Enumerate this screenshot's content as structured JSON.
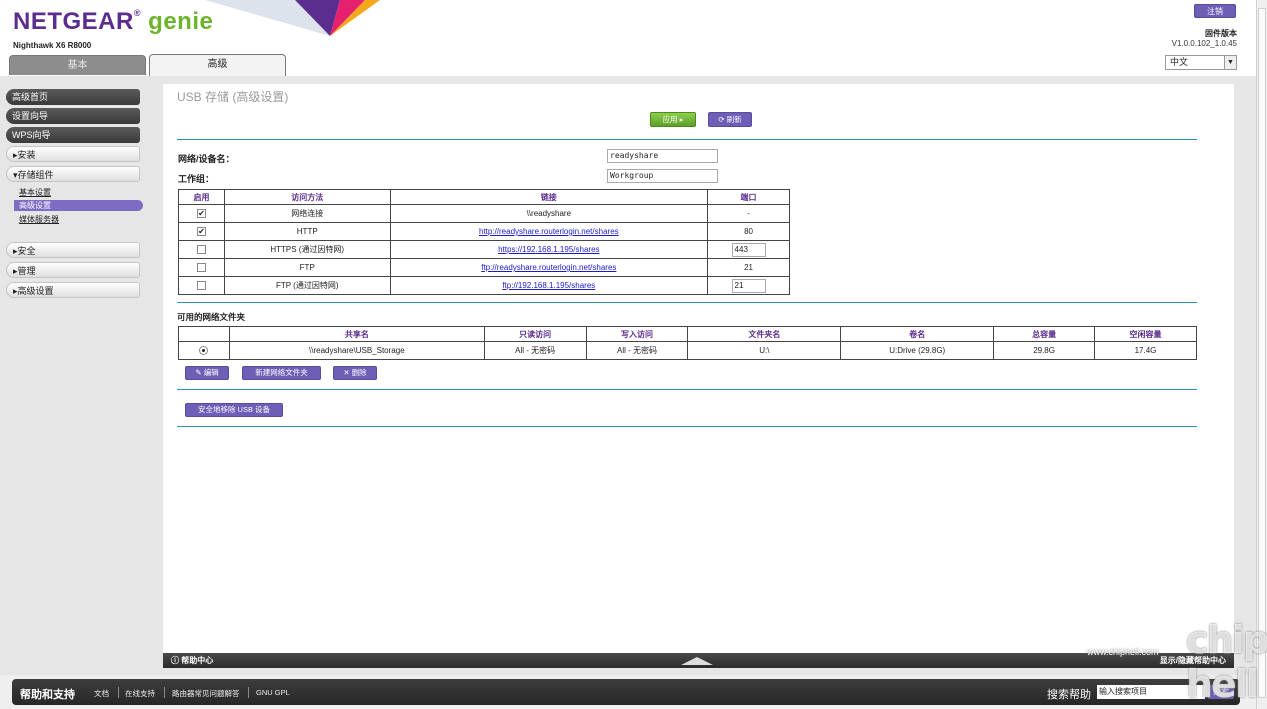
{
  "header": {
    "brand": "NETGEAR",
    "brand_reg": "®",
    "brand_product": "genie",
    "model": "Nighthawk X6 R8000",
    "logout_label": "注销",
    "firmware_label": "固件版本",
    "firmware_version": "V1.0.0.102_1.0.45",
    "language": "中文"
  },
  "tabs": [
    {
      "label": "基本"
    },
    {
      "label": "高级"
    }
  ],
  "sidebar": {
    "items": [
      {
        "label": "高级首页"
      },
      {
        "label": "设置向导"
      },
      {
        "label": "WPS向导"
      },
      {
        "label": "▸安装"
      },
      {
        "label": "▾存储组件"
      },
      {
        "label": "▸安全"
      },
      {
        "label": "▸管理"
      },
      {
        "label": "▸高级设置"
      }
    ],
    "storage_sub": [
      {
        "label": "基本设置"
      },
      {
        "label": "高级设置"
      },
      {
        "label": "媒体服务器"
      }
    ]
  },
  "main": {
    "title": "USB 存储 (高级设置)",
    "apply_label": "应用 ▸",
    "refresh_label": "⟳ 刷新",
    "device_name_label": "网络/设备名：",
    "device_name_value": "readyshare",
    "workgroup_label": "工作组：",
    "workgroup_value": "Workgroup",
    "access_table": {
      "headers": [
        "启用",
        "访问方法",
        "链接",
        "端口"
      ],
      "rows": [
        {
          "enabled": true,
          "method": "网络连接",
          "link": "\\\\readyshare",
          "link_is_url": false,
          "port": "-",
          "port_editable": false
        },
        {
          "enabled": true,
          "method": "HTTP",
          "link": "http://readyshare.routerlogin.net/shares",
          "link_is_url": true,
          "port": "80",
          "port_editable": false
        },
        {
          "enabled": false,
          "method": "HTTPS (通过因特网)",
          "link": "https://192.168.1.195/shares",
          "link_is_url": true,
          "port": "443",
          "port_editable": true
        },
        {
          "enabled": false,
          "method": "FTP",
          "link": "ftp://readyshare.routerlogin.net/shares",
          "link_is_url": true,
          "port": "21",
          "port_editable": false
        },
        {
          "enabled": false,
          "method": "FTP (通过因特网)",
          "link": "ftp://192.168.1.195/shares",
          "link_is_url": true,
          "port": "21",
          "port_editable": true
        }
      ]
    },
    "folders_title": "可用的网络文件夹",
    "folders_table": {
      "headers": [
        "",
        "共享名",
        "只读访问",
        "写入访问",
        "文件夹名",
        "卷名",
        "总容量",
        "空闲容量"
      ],
      "rows": [
        {
          "selected": true,
          "share": "\\\\readyshare\\USB_Storage",
          "read": "All - 无密码",
          "write": "All - 无密码",
          "folder": "U:\\",
          "volume": "U:Drive (29.8G)",
          "total": "29.8G",
          "free": "17.4G"
        }
      ]
    },
    "edit_label": "编辑",
    "new_folder_label": "新建网络文件夹",
    "delete_label": "删除",
    "safe_remove_label": "安全地移除 USB 设备"
  },
  "help_bar": {
    "left": "帮助中心",
    "right": "显示/隐藏帮助中心"
  },
  "footer": {
    "title": "帮助和支持",
    "links": [
      "文档",
      "在线支持",
      "路由器常见问题解答",
      "GNU GPL"
    ],
    "search_label": "搜索帮助",
    "search_placeholder": "输入搜索项目",
    "search_button": "搜索"
  },
  "watermark": {
    "text": "chip hell",
    "url": "www.chiphell.com"
  },
  "colors": {
    "brand_purple": "#5b2d8e",
    "brand_green": "#6cb42c",
    "button_purple": "#6f5eb5",
    "rule_teal": "#2a8fa8"
  }
}
